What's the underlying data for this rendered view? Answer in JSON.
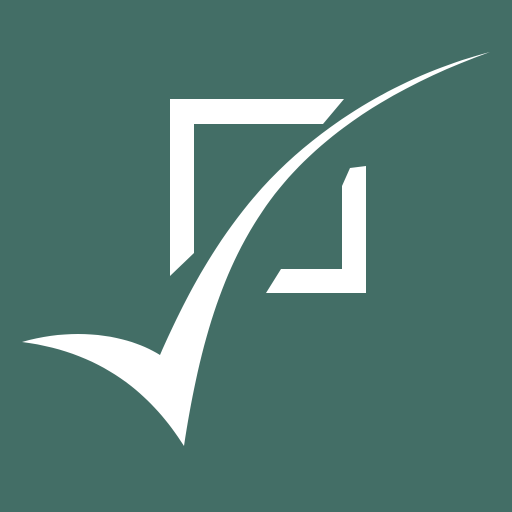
{
  "logo": {
    "icon": "checkbox-checkmark-icon",
    "colors": {
      "background": "#436e66",
      "foreground": "#ffffff"
    }
  }
}
